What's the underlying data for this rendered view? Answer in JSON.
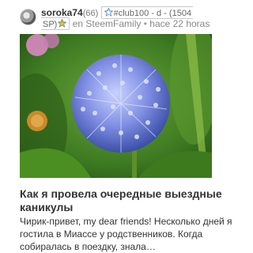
{
  "post": {
    "author": "soroka74",
    "reputation": "(66)",
    "community_tag": "#club100 - d - (1504",
    "community_tag_cont": "SP)",
    "in_label": "en SteemFamily",
    "separator": "•",
    "time": "hace 22 horas",
    "title": "Как я провела очередные выездные каникулы",
    "excerpt": "Чирик-привет, my dear friends! Несколько дней я гостила в Миассе у родственников. Когда собиралась в поездку, знала…"
  },
  "colors": {
    "star": "#f2c200",
    "star_stroke": "#2f6fd0",
    "flower": "#7e8fe0",
    "foliage": "#4d8a2a"
  },
  "icons": {
    "avatar": "user-avatar",
    "star": "star-icon"
  }
}
